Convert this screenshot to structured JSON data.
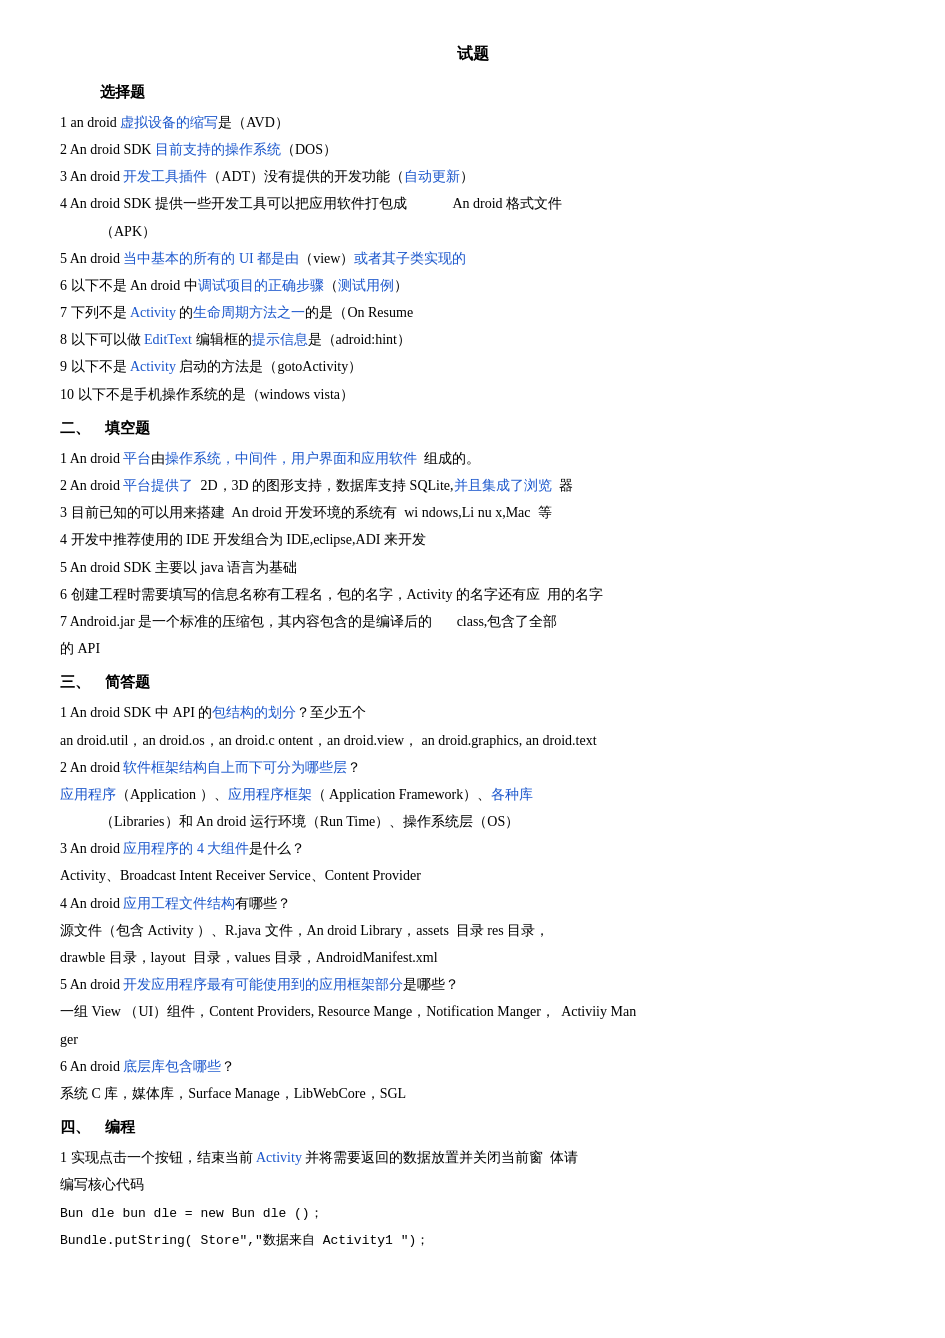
{
  "page": {
    "title": "试题",
    "sections": [
      {
        "id": "section1",
        "title": "选择题",
        "title_indent": "indent",
        "questions": [
          "1 an droid 虚拟设备的缩写是（AVD）",
          "2 An droid SDK 目前支持的操作系统（DOS）",
          "3 An droid 开发工具插件（ADT）没有提供的开发功能（自动更新）",
          "4 An droid SDK 提供一些开发工具可以把应用软件打包成             An droid 格式文件（APK）",
          "5 An droid 当中基本的所有的 UI 都是由（view）或者其子类实现的",
          "6 以下不是 An droid 中调试项目的正确步骤（测试用例）",
          "7 下列不是 Activity 的生命周期方法之一的是（On Resume",
          "8 以下可以做 EditText 编辑框的提示信息是（adroid:hint）",
          "9 以下不是 Activity 启动的方法是（gotoActivity）",
          "10 以下不是手机操作系统的是（windows vista）"
        ]
      },
      {
        "id": "section2",
        "title": "二、    填空题",
        "questions": [
          "1 An droid 平台由操作系统，中间件，用户界面和应用软件  组成的。",
          "2 An droid 平台提供了  2D，3D 的图形支持，数据库支持 SQLite,并且集成了浏览  器",
          "3 目前已知的可以用来搭建  An droid 开发环境的系统有  wi ndows,Li nu x,Mac  等",
          "4 开发中推荐使用的 IDE 开发组合为 IDE,eclipse,ADI 来开发",
          "5 An droid SDK 主要以 java 语言为基础",
          "6 创建工程时需要填写的信息名称有工程名，包的名字，Activity 的名字还有应  用的名字",
          "7 Android.jar 是一个标准的压缩包，其内容包含的是编译后的       class,包含了全部的 API"
        ]
      },
      {
        "id": "section3",
        "title": "三、    简答题",
        "questions": [
          {
            "q": "1 An droid SDK 中 API 的包结构的划分？至少五个",
            "a": "an droid.util，an droid.os，an droid.c ontent，an droid.view， an droid.graphics, an droid.text"
          },
          {
            "q": "2 An droid 软件框架结构自上而下可分为哪些层？",
            "a": "应用程序（Application ）、应用程序框架（ Application Framework）、各种库（Libraries）和  An droid 运行环境（Run Time）、操作系统层（OS）"
          },
          {
            "q": "3 An droid 应用程序的 4 大组件是什么？",
            "a": "Activity、Broadcast Intent Receiver Service、Content Provider"
          },
          {
            "q": "4 An droid 应用工程文件结构有哪些？",
            "a": "源文件（包含 Activity ）、R.java 文件，An droid Library，assets  目录 res 目录，drawble 目录，layout  目录，values 目录，AndroidManifest.xml"
          },
          {
            "q": "5 An droid 开发应用程序最有可能使用到的应用框架部分是哪些？",
            "a": "一组 View （UI）组件，Content Providers, Resource Mange， Notification Manger，  Activiiy Manager"
          },
          {
            "q": "6 An droid 底层库包含哪些？",
            "a": "系统 C 库，媒体库，Surface Manage，LibWebCore，SGL"
          }
        ]
      },
      {
        "id": "section4",
        "title": "四、    编程",
        "questions": [
          {
            "q": "1 实现点击一个按钮，结束当前 Activity 并将需要返回的数据放置并关闭当前窗  体请编写核心代码",
            "code": [
              "Bun dle bun dle = new Bun dle ()；",
              "Bundle.putString( Store\",\"数据来自 Activity1 \")；"
            ]
          }
        ]
      }
    ]
  }
}
